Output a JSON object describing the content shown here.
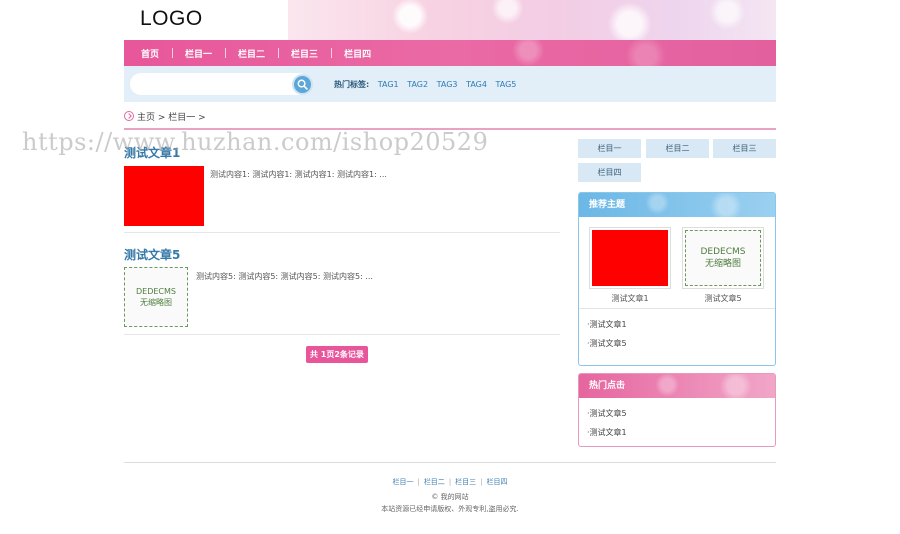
{
  "header": {
    "logo_text": "LOGO"
  },
  "nav": {
    "items": [
      "首页",
      "栏目一",
      "栏目二",
      "栏目三",
      "栏目四"
    ]
  },
  "search": {
    "value": "",
    "placeholder": "",
    "hot_label": "热门标签:",
    "tags": [
      "TAG1",
      "TAG2",
      "TAG3",
      "TAG4",
      "TAG5"
    ]
  },
  "breadcrumb": {
    "text": "主页 > 栏目一 >"
  },
  "watermark": {
    "text": "https://www.huzhan.com/ishop20529"
  },
  "articles": [
    {
      "title": "测试文章1",
      "desc": "测试内容1:  测试内容1:  测试内容1:  测试内容1: ..."
    },
    {
      "title": "测试文章5",
      "desc": "测试内容5:  测试内容5:  测试内容5:  测试内容5: ...",
      "placeholder_line1": "DEDECMS",
      "placeholder_line2": "无缩略图"
    }
  ],
  "pager": {
    "text": "共 1页2条记录"
  },
  "sidebar": {
    "subnav": [
      "栏目一",
      "栏目二",
      "栏目三",
      "栏目四"
    ],
    "recommend": {
      "title": "推荐主题",
      "pics": [
        {
          "caption": "测试文章1"
        },
        {
          "caption": "测试文章5",
          "placeholder_line1": "DEDECMS",
          "placeholder_line2": "无缩略图"
        }
      ],
      "list": [
        "·测试文章1",
        "·测试文章5"
      ]
    },
    "hot": {
      "title": "热门点击",
      "list": [
        "·测试文章5",
        "·测试文章1"
      ]
    }
  },
  "footer": {
    "links": [
      "栏目一",
      "栏目二",
      "栏目三",
      "栏目四"
    ],
    "copyright": "© 我的网站",
    "note": "本站资源已经申请版权、外观专利,盗用必究."
  },
  "colors": {
    "nav_pink": "#e7579a",
    "search_bg": "#e3eff8",
    "link_blue": "#3479a8",
    "pager_pink": "#e8559b"
  }
}
